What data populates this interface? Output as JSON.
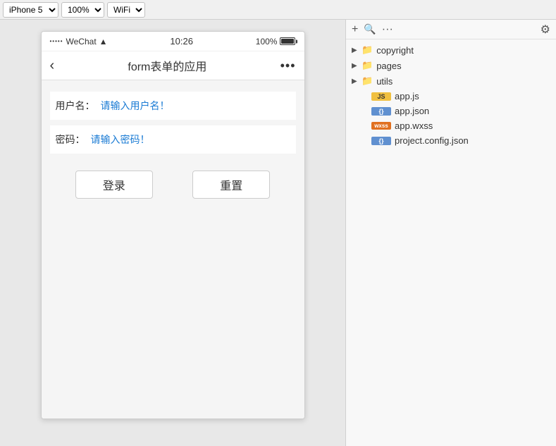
{
  "toolbar": {
    "device_label": "iPhone 5",
    "zoom_label": "100%",
    "network_label": "WiFi"
  },
  "phone": {
    "status_bar": {
      "dots": "•••••",
      "carrier": "WeChat",
      "wifi": "▲",
      "time": "10:26",
      "battery_percent": "100%"
    },
    "nav": {
      "back_icon": "‹",
      "title": "form表单的应用",
      "more_icon": "•••"
    },
    "form": {
      "username_label": "用户名：",
      "username_placeholder": "请输入用户名！",
      "password_label": "密码：",
      "password_placeholder": "请输入密码！",
      "login_button": "登录",
      "reset_button": "重置"
    }
  },
  "file_tree": {
    "add_icon": "+",
    "search_icon": "🔍",
    "more_icon": "···",
    "settings_icon": "⚙",
    "items": [
      {
        "type": "folder",
        "name": "copyright",
        "expanded": false,
        "indent": 0
      },
      {
        "type": "folder",
        "name": "pages",
        "expanded": false,
        "indent": 0
      },
      {
        "type": "folder",
        "name": "utils",
        "expanded": false,
        "indent": 0
      },
      {
        "type": "file",
        "name": "app.js",
        "badge": "JS",
        "badge_type": "js",
        "indent": 1
      },
      {
        "type": "file",
        "name": "app.json",
        "badge": "{}",
        "badge_type": "json",
        "indent": 1
      },
      {
        "type": "file",
        "name": "app.wxss",
        "badge": "wxss",
        "badge_type": "wxss",
        "indent": 1
      },
      {
        "type": "file",
        "name": "project.config.json",
        "badge": "{}",
        "badge_type": "json",
        "indent": 1
      }
    ]
  }
}
